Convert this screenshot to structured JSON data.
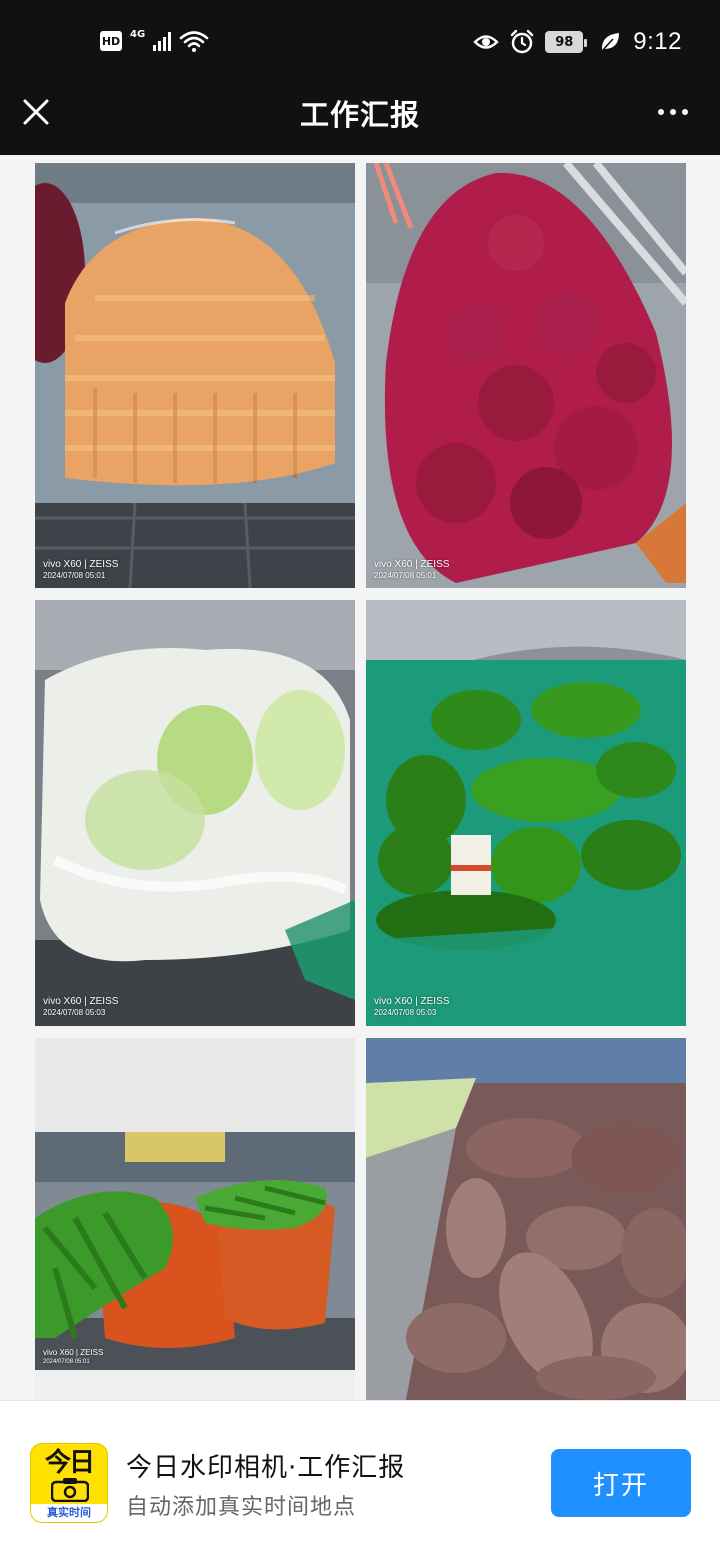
{
  "status_bar": {
    "hd": "HD",
    "network": "4G",
    "battery": "98",
    "time": "9:12",
    "icons": [
      "hd-icon",
      "signal-icon",
      "wifi-icon",
      "eye-icon",
      "alarm-icon",
      "battery-icon",
      "leaf-icon"
    ]
  },
  "nav": {
    "title": "工作汇报",
    "close_icon": "close-icon",
    "more_icon": "more-icon"
  },
  "photos": [
    {
      "subject": "carrots",
      "brand": "vivo X60 | ZEISS",
      "date": "2024/07/08 05:01"
    },
    {
      "subject": "red-onions",
      "brand": "vivo X60 | ZEISS",
      "date": "2024/07/08 05:01"
    },
    {
      "subject": "cabbage",
      "brand": "vivo X60 | ZEISS",
      "date": "2024/07/08 05:03"
    },
    {
      "subject": "green-peppers",
      "brand": "vivo X60 | ZEISS",
      "date": "2024/07/08 05:03"
    },
    {
      "subject": "garlic-sprouts",
      "brand": "vivo X60 | ZEISS",
      "date": "2024/07/08 05:01"
    },
    {
      "subject": "sweet-potatoes",
      "brand": "",
      "date": ""
    }
  ],
  "banner": {
    "logo_top": "今日",
    "logo_bottom": "真实时间",
    "app_name": "今日水印相机·工作汇报",
    "app_desc": "自动添加真实时间地点",
    "open_label": "打开"
  },
  "colors": {
    "bar_bg": "#111111",
    "accent": "#1e90ff",
    "logo_yellow": "#ffe100"
  }
}
